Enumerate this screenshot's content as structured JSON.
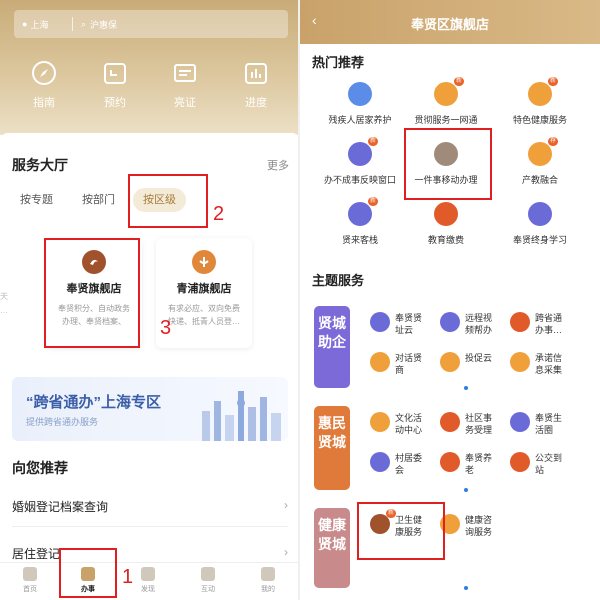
{
  "left": {
    "location": "上海",
    "search_placeholder": "沪惠保",
    "quick_actions": [
      {
        "label": "指南",
        "icon": "compass-icon"
      },
      {
        "label": "预约",
        "icon": "calendar-icon"
      },
      {
        "label": "亮证",
        "icon": "id-card-icon"
      },
      {
        "label": "进度",
        "icon": "progress-chart-icon"
      }
    ],
    "service_hall_title": "服务大厅",
    "more_label": "更多",
    "tabs": [
      "按专题",
      "按部门",
      "按区级"
    ],
    "shops": [
      {
        "name": "奉贤旗舰店",
        "desc1": "奉贤积分、自动政务",
        "desc2": "办理、奉贤档案、",
        "color": "#a0522d"
      },
      {
        "name": "青浦旗舰店",
        "desc1": "有求必应、双向免费",
        "desc2": "快递、抵青人员登…",
        "color": "#e0873a"
      }
    ],
    "shop_edge_left": "天\n…",
    "shop_edge_right": "",
    "banner_title": "“跨省通办”上海专区",
    "banner_sub": "提供跨省通办服务",
    "recommend_title": "向您推荐",
    "recommend_items": [
      "婚姻登记档案查询",
      "居住登记"
    ],
    "tabbar": [
      "首页",
      "办事",
      "发现",
      "互动",
      "我的"
    ],
    "annotations": [
      "1",
      "2",
      "3"
    ]
  },
  "right": {
    "title": "奉贤区旗舰店",
    "hot_title": "热门推荐",
    "hot_items": [
      {
        "label": "残疾人居家养护",
        "color": "#5b8de8",
        "badge": ""
      },
      {
        "label": "贯彻服务一网通",
        "color": "#f0a03a",
        "badge": "新"
      },
      {
        "label": "特色健康服务",
        "color": "#f0a03a",
        "badge": "新"
      },
      {
        "label": "办不成事反映窗口",
        "color": "#6b6bd8",
        "badge": "新"
      },
      {
        "label": "一件事移动办理",
        "color": "#a08a7a",
        "badge": ""
      },
      {
        "label": "产教融合",
        "color": "#f0a03a",
        "badge": "荐"
      },
      {
        "label": "贤来客栈",
        "color": "#6b6bd8",
        "badge": "新"
      },
      {
        "label": "教育缴费",
        "color": "#e05a2a",
        "badge": ""
      },
      {
        "label": "奉贤终身学习",
        "color": "#6b6bd8",
        "badge": ""
      }
    ],
    "theme_title": "主题服务",
    "themes": [
      {
        "label": "贤城助企",
        "color": "#7c6ad8",
        "items": [
          {
            "text": "奉贤贤\n址云",
            "color": "#6b6bd8"
          },
          {
            "text": "远程视\n频帮办",
            "color": "#6b6bd8"
          },
          {
            "text": "跨省通\n办事…",
            "color": "#e05a2a"
          },
          {
            "text": "对话贤\n商",
            "color": "#f0a03a"
          },
          {
            "text": "投促云",
            "color": "#f0a03a"
          },
          {
            "text": "承诺信\n息采集",
            "color": "#f0a03a"
          }
        ]
      },
      {
        "label": "惠民贤城",
        "color": "#e07a3a",
        "items": [
          {
            "text": "文化活\n动中心",
            "color": "#f0a03a"
          },
          {
            "text": "社区事\n务受理",
            "color": "#e05a2a"
          },
          {
            "text": "奉贤生\n活圈",
            "color": "#6b6bd8"
          },
          {
            "text": "村居委\n会",
            "color": "#6b6bd8"
          },
          {
            "text": "奉贤养\n老",
            "color": "#e05a2a"
          },
          {
            "text": "公交到\n站",
            "color": "#e05a2a"
          }
        ]
      },
      {
        "label": "健康贤城",
        "color": "#c88a8a",
        "items": [
          {
            "text": "卫生健\n康服务",
            "color": "#a0522d",
            "badge": "新"
          },
          {
            "text": "健康咨\n询服务",
            "color": "#f0a03a"
          }
        ]
      }
    ]
  }
}
